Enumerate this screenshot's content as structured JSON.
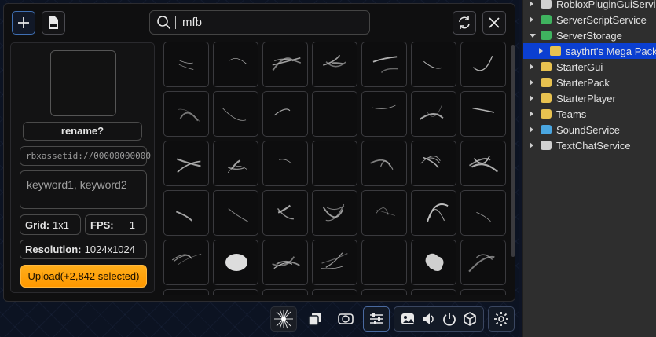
{
  "search": {
    "value": "mfb",
    "placeholder": ""
  },
  "side": {
    "rename_label": "rename?",
    "asset_id_placeholder": "rbxassetid://00000000000",
    "keywords_placeholder": "keyword1, keyword2",
    "grid_label": "Grid:",
    "grid_value": "1x1",
    "fps_label": "FPS:",
    "fps_value": "1",
    "resolution_label": "Resolution:",
    "resolution_value": "1024x1024",
    "upload_label": "Upload(+2,842 selected)"
  },
  "icons": {
    "add": "plus-icon",
    "import": "image-file-icon",
    "search": "search-icon",
    "refresh": "refresh-icon",
    "close": "close-icon"
  },
  "toolbar": [
    "effect-preview-icon",
    "layers-icon",
    "sync-icon",
    "sliders-icon",
    "image-icon",
    "volume-icon",
    "power-icon",
    "cube-icon",
    "gear-icon"
  ],
  "explorer": {
    "items": [
      {
        "label": "RobloxPluginGuiService",
        "icon": "service",
        "expanded": false,
        "selected": false,
        "indent": 0
      },
      {
        "label": "ServerScriptService",
        "icon": "script-service",
        "expanded": false,
        "selected": false,
        "indent": 0
      },
      {
        "label": "ServerStorage",
        "icon": "storage",
        "expanded": true,
        "selected": false,
        "indent": 0
      },
      {
        "label": "saythrt's Mega Pack",
        "icon": "folder",
        "expanded": false,
        "selected": true,
        "indent": 1
      },
      {
        "label": "StarterGui",
        "icon": "starter-gui",
        "expanded": false,
        "selected": false,
        "indent": 0
      },
      {
        "label": "StarterPack",
        "icon": "starter-pack",
        "expanded": false,
        "selected": false,
        "indent": 0
      },
      {
        "label": "StarterPlayer",
        "icon": "starter-player",
        "expanded": false,
        "selected": false,
        "indent": 0
      },
      {
        "label": "Teams",
        "icon": "teams",
        "expanded": false,
        "selected": false,
        "indent": 0
      },
      {
        "label": "SoundService",
        "icon": "sound",
        "expanded": false,
        "selected": false,
        "indent": 0
      },
      {
        "label": "TextChatService",
        "icon": "chat",
        "expanded": false,
        "selected": false,
        "indent": 0
      }
    ]
  },
  "colors": {
    "accent_orange": "#ff9f0d",
    "selection_blue": "#0b3fd1",
    "panel_bg": "#0f0f10"
  }
}
